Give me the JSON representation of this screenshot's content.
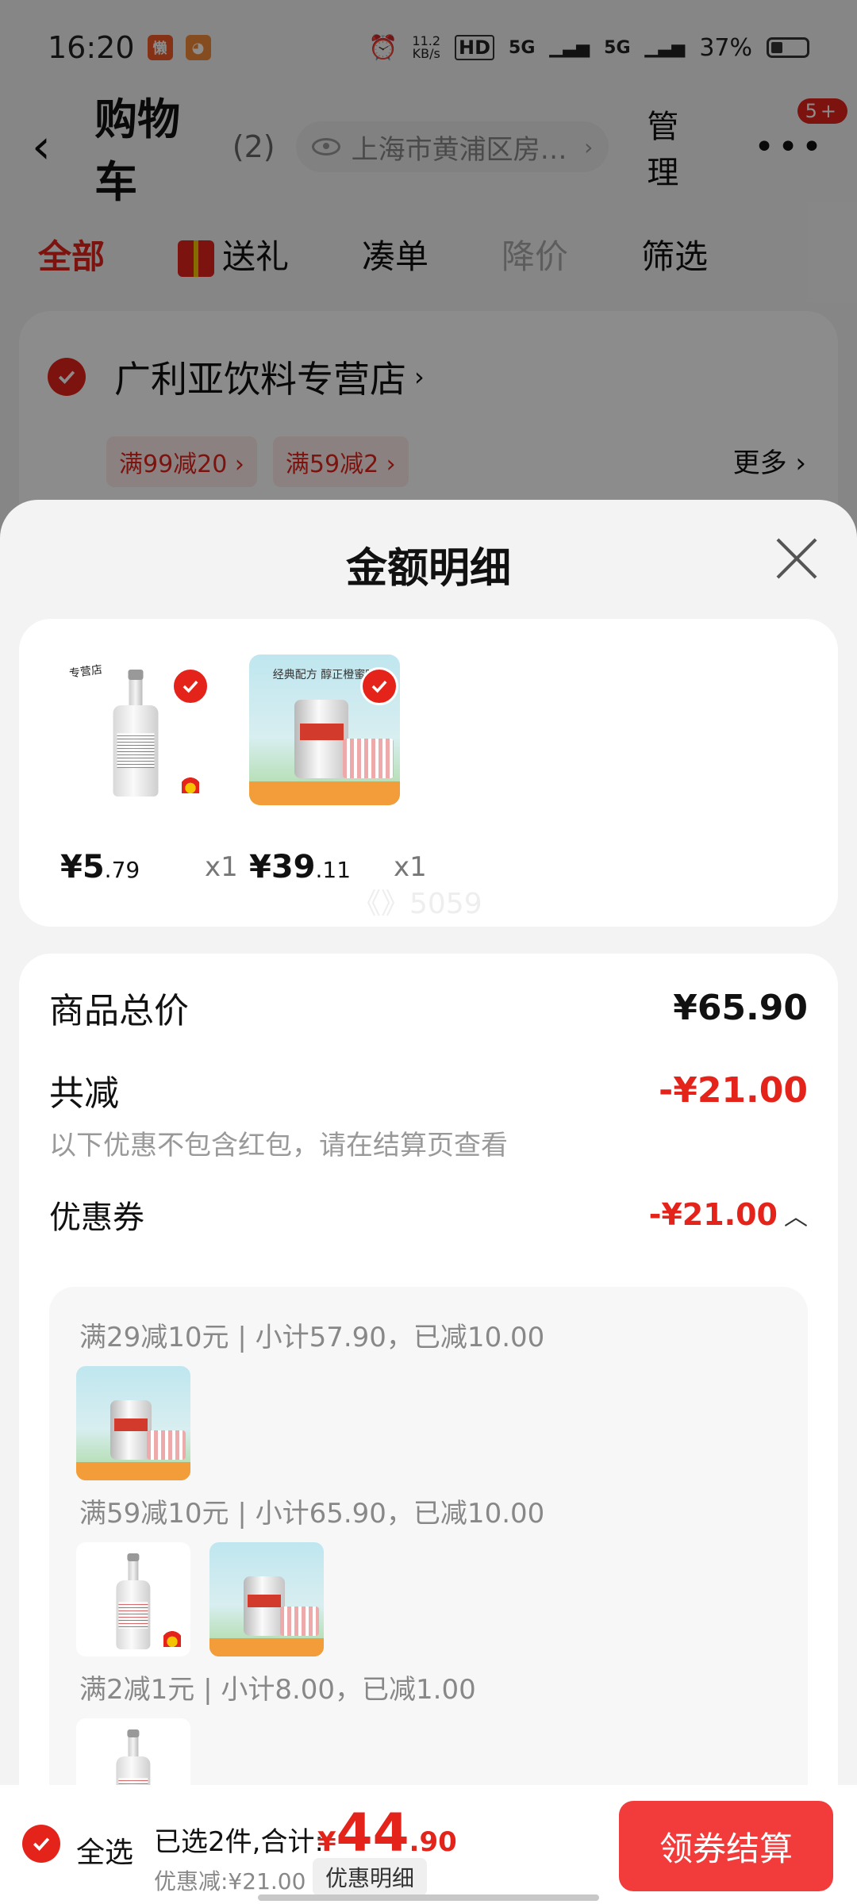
{
  "statusbar": {
    "time": "16:20",
    "speed": "11.2",
    "speed_unit": "KB/s",
    "hd": "HD",
    "net1": "5G",
    "net2": "5G",
    "battery": "37%"
  },
  "navbar": {
    "back": "‹",
    "title": "购物车",
    "count": "(2)",
    "location": "上海市黄浦区房…",
    "manage": "管理",
    "more": "•••",
    "badge": "5+"
  },
  "tabs": [
    {
      "label": "全部"
    },
    {
      "label": "送礼"
    },
    {
      "label": "凑单"
    },
    {
      "label": "降价"
    },
    {
      "label": "筛选"
    }
  ],
  "store": {
    "name": "广利亚饮料专营店",
    "promos": [
      "满99减20 ›",
      "满59减2 ›"
    ],
    "more": "更多 ›"
  },
  "sheet": {
    "title": "金额明细",
    "items": [
      {
        "price_int": "¥5",
        "price_dec": ".79",
        "qty": "x1",
        "brand_text": "专营店"
      },
      {
        "price_int": "¥39",
        "price_dec": ".11",
        "qty": "x1",
        "banner_title": "经典配方 醇正橙蜜味"
      }
    ],
    "watermark": "《》5059",
    "summary": {
      "total_label": "商品总价",
      "total_value": "¥65.90",
      "discount_label": "共减",
      "discount_value": "-¥21.00",
      "note": "以下优惠不包含红包，请在结算页查看",
      "coupon_label": "优惠券",
      "coupon_value": "-¥21.00"
    },
    "coupon_details": [
      {
        "text": "满29减10元 | 小计57.90，已减10.00"
      },
      {
        "text": "满59减10元 | 小计65.90，已减10.00"
      },
      {
        "text": "满2减1元 | 小计8.00，已减1.00"
      }
    ]
  },
  "bottombar": {
    "select_all": "全选",
    "selected": "已选2件,合计:",
    "currency": "¥",
    "total_int": "44",
    "total_dec": ".90",
    "discount": "优惠减:¥21.00",
    "detail_button": "优惠明细",
    "checkout": "领券结算"
  },
  "colors": {
    "accent": "#e4231b",
    "checkout_bg": "#f23b3b"
  }
}
